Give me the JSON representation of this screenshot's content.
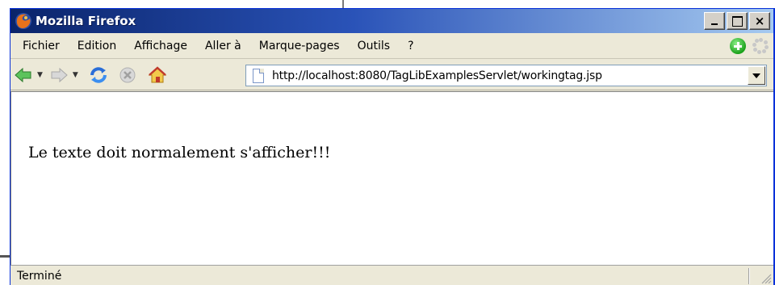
{
  "window": {
    "title": "Mozilla Firefox",
    "controls": {
      "minimize": "_",
      "maximize": "□",
      "close": "×"
    }
  },
  "menubar": {
    "items": [
      {
        "label": "Fichier"
      },
      {
        "label": "Edition"
      },
      {
        "label": "Affichage"
      },
      {
        "label": "Aller à"
      },
      {
        "label": "Marque-pages"
      },
      {
        "label": "Outils"
      },
      {
        "label": "?"
      }
    ]
  },
  "toolbar": {
    "url": "http://localhost:8080/TagLibExamplesServlet/workingtag.jsp"
  },
  "page": {
    "text": "Le texte doit normalement s'afficher!!!"
  },
  "status": {
    "text": "Terminé"
  },
  "colors": {
    "titlebar_start": "#0a246a",
    "titlebar_end": "#a6caf0",
    "chrome": "#ece9d8"
  },
  "icons": [
    "firefox-logo-icon",
    "back-arrow-icon",
    "forward-arrow-icon",
    "reload-icon",
    "stop-icon",
    "home-icon",
    "page-icon",
    "green-plus-icon",
    "throbber-icon"
  ]
}
